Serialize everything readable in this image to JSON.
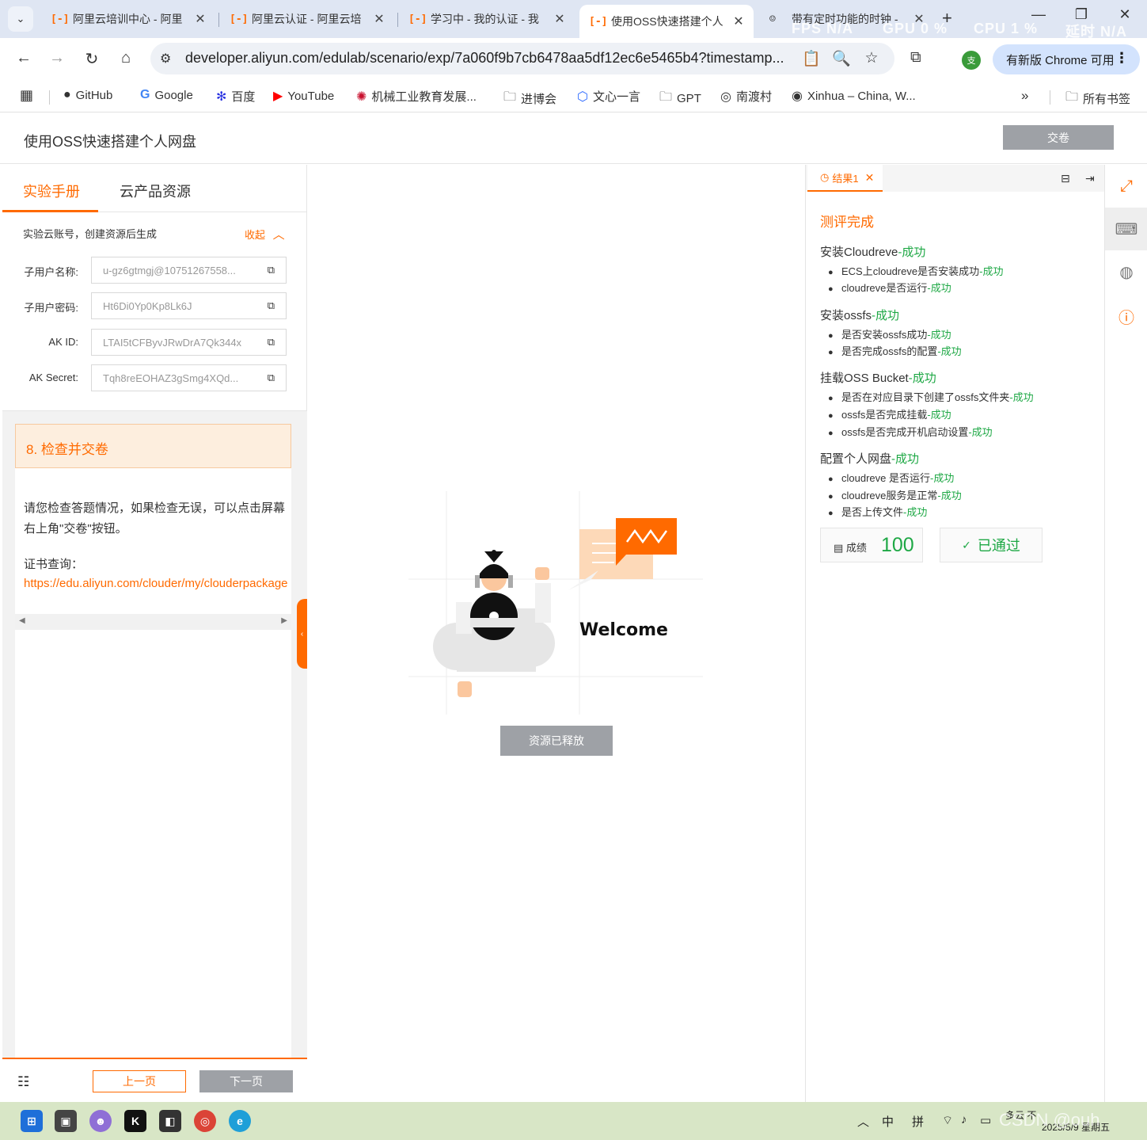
{
  "browser": {
    "tabs": [
      {
        "title": "阿里云培训中心 - 阿里",
        "favicon": "aliyun-logo"
      },
      {
        "title": "阿里云认证 - 阿里云培",
        "favicon": "aliyun-logo"
      },
      {
        "title": "学习中 - 我的认证 - 我",
        "favicon": "aliyun-logo"
      },
      {
        "title": "使用OSS快速搭建个人",
        "favicon": "aliyun-logo"
      },
      {
        "title": "带有定时功能的时钟 -",
        "favicon": "avatar"
      }
    ],
    "active_tab_index": 3,
    "perf_overlay": {
      "fps": "FPS  N/A",
      "gpu": "GPU  0 %",
      "cpu": "CPU  1 %",
      "latency": "延时  N/A"
    },
    "url": "developer.aliyun.com/edulab/scenario/exp/7a060f9b7cb6478aa5df12ec6e5465b4?timestamp...",
    "profile_initial": "支",
    "update_chip": "有新版 Chrome 可用",
    "bookmarks": [
      "GitHub",
      "Google",
      "百度",
      "YouTube",
      "机械工业教育发展...",
      "进博会",
      "文心一言",
      "GPT",
      "南渡村",
      "Xinhua – China, W..."
    ],
    "all_bookmarks": "所有书签"
  },
  "page": {
    "title": "使用OSS快速搭建个人网盘",
    "submit_label": "交卷"
  },
  "left_panel": {
    "tabs": [
      "实验手册",
      "云产品资源"
    ],
    "account_header": "实验云账号，创建资源后生成",
    "collapse_label": "收起",
    "fields": [
      {
        "label": "子用户名称:",
        "value": "u-gz6gtmgj@10751267558..."
      },
      {
        "label": "子用户密码:",
        "value": "Ht6Di0Yp0Kp8Lk6J"
      },
      {
        "label": "AK ID:",
        "value": "LTAI5tCFByvJRwDrA7Qk344x"
      },
      {
        "label": "AK Secret:",
        "value": "Tqh8reEOHAZ3gSmg4XQd..."
      }
    ],
    "step_title": "8. 检查并交卷",
    "step_text": "请您检查答题情况，如果检查无误，可以点击屏幕右上角\"交卷\"按钮。",
    "cert_label": "证书查询：",
    "cert_link": "https://edu.aliyun.com/clouder/my/clouderpackage",
    "prev_label": "上一页",
    "next_label": "下一页"
  },
  "center": {
    "welcome": "Welcome",
    "release_label": "资源已释放"
  },
  "result": {
    "tab_label": "结果1",
    "eval_title": "测评完成",
    "groups": [
      {
        "title": "安装Cloudreve",
        "status": "-成功",
        "items": [
          {
            "text": "ECS上cloudreve是否安装成功",
            "status": "-成功"
          },
          {
            "text": "cloudreve是否运行",
            "status": "-成功"
          }
        ]
      },
      {
        "title": "安装ossfs",
        "status": "-成功",
        "items": [
          {
            "text": "是否安装ossfs成功",
            "status": "-成功"
          },
          {
            "text": "是否完成ossfs的配置",
            "status": "-成功"
          }
        ]
      },
      {
        "title": "挂载OSS Bucket",
        "status": "-成功",
        "items": [
          {
            "text": "是否在对应目录下创建了ossfs文件夹",
            "status": "-成功"
          },
          {
            "text": "ossfs是否完成挂载",
            "status": "-成功"
          },
          {
            "text": "ossfs是否完成开机启动设置",
            "status": "-成功"
          }
        ]
      },
      {
        "title": "配置个人网盘",
        "status": "-成功",
        "items": [
          {
            "text": "cloudreve 是否运行",
            "status": "-成功"
          },
          {
            "text": "cloudreve服务是正常",
            "status": "-成功"
          },
          {
            "text": "是否上传文件",
            "status": "-成功"
          }
        ]
      }
    ],
    "score_label": "成绩",
    "score_value": "100",
    "pass_label": "已通过"
  },
  "taskbar": {
    "ime_zh": "中",
    "ime_pin": "拼",
    "date": "2025/5/9 星期五",
    "tray_text": "多云 不",
    "watermark": "CSDN @ouh"
  },
  "colors": {
    "accent": "#ff6a00",
    "success": "#1ea845",
    "disabled": "#9ea1a6"
  }
}
